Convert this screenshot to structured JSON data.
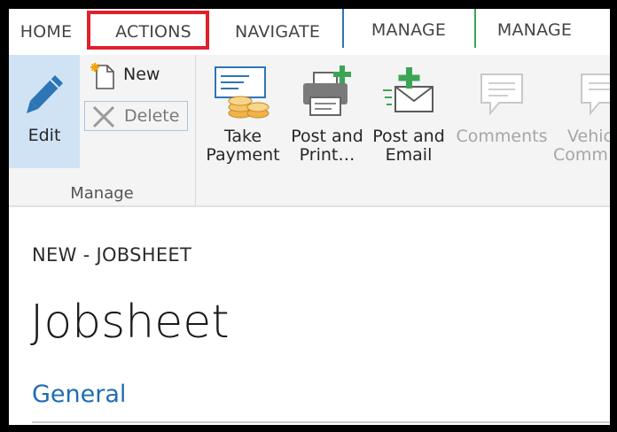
{
  "tabs": [
    {
      "label": "HOME"
    },
    {
      "label": "ACTIONS"
    },
    {
      "label": "NAVIGATE"
    },
    {
      "label": "MANAGE"
    },
    {
      "label": "MANAGE"
    }
  ],
  "ribbon": {
    "edit_label": "Edit",
    "new_label": "New",
    "delete_label": "Delete",
    "group_label": "Manage",
    "take_payment": [
      "Take",
      "Payment"
    ],
    "post_print": [
      "Post and",
      "Print…"
    ],
    "post_email": [
      "Post and",
      "Email"
    ],
    "comments": "Comments",
    "vehicle": [
      "Vehic",
      "Comm"
    ]
  },
  "page": {
    "breadcrumb": "NEW - JOBSHEET",
    "title": "Jobsheet",
    "section": "General"
  },
  "colors": {
    "highlight": "#e0202b",
    "selected": "#cfe3f5",
    "link": "#1f6db3",
    "tab_sep_blue": "#2e75b6",
    "tab_sep_green": "#3aa655"
  }
}
